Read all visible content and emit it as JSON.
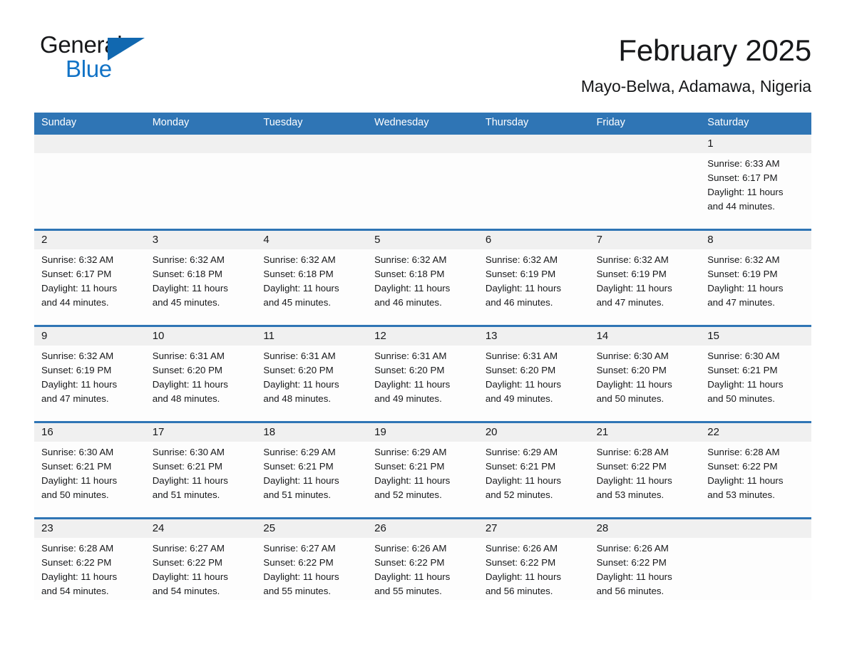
{
  "brand": {
    "name_part1": "General",
    "name_part2": "Blue",
    "triangle_icon": "brand-triangle-icon",
    "colors": {
      "black": "#17181a",
      "blue": "#1273c6",
      "triangle": "#1168b0"
    }
  },
  "header": {
    "title": "February 2025",
    "subtitle": "Mayo-Belwa, Adamawa, Nigeria"
  },
  "theme": {
    "header_blue": "#2f75b5",
    "day_band_gray": "#f0f0f0",
    "page_bg": "#ffffff",
    "text": "#17181a"
  },
  "weekdays": [
    "Sunday",
    "Monday",
    "Tuesday",
    "Wednesday",
    "Thursday",
    "Friday",
    "Saturday"
  ],
  "weeks": [
    [
      {
        "day": "",
        "lines": []
      },
      {
        "day": "",
        "lines": []
      },
      {
        "day": "",
        "lines": []
      },
      {
        "day": "",
        "lines": []
      },
      {
        "day": "",
        "lines": []
      },
      {
        "day": "",
        "lines": []
      },
      {
        "day": "1",
        "lines": [
          "Sunrise: 6:33 AM",
          "Sunset: 6:17 PM",
          "Daylight: 11 hours",
          "and 44 minutes."
        ]
      }
    ],
    [
      {
        "day": "2",
        "lines": [
          "Sunrise: 6:32 AM",
          "Sunset: 6:17 PM",
          "Daylight: 11 hours",
          "and 44 minutes."
        ]
      },
      {
        "day": "3",
        "lines": [
          "Sunrise: 6:32 AM",
          "Sunset: 6:18 PM",
          "Daylight: 11 hours",
          "and 45 minutes."
        ]
      },
      {
        "day": "4",
        "lines": [
          "Sunrise: 6:32 AM",
          "Sunset: 6:18 PM",
          "Daylight: 11 hours",
          "and 45 minutes."
        ]
      },
      {
        "day": "5",
        "lines": [
          "Sunrise: 6:32 AM",
          "Sunset: 6:18 PM",
          "Daylight: 11 hours",
          "and 46 minutes."
        ]
      },
      {
        "day": "6",
        "lines": [
          "Sunrise: 6:32 AM",
          "Sunset: 6:19 PM",
          "Daylight: 11 hours",
          "and 46 minutes."
        ]
      },
      {
        "day": "7",
        "lines": [
          "Sunrise: 6:32 AM",
          "Sunset: 6:19 PM",
          "Daylight: 11 hours",
          "and 47 minutes."
        ]
      },
      {
        "day": "8",
        "lines": [
          "Sunrise: 6:32 AM",
          "Sunset: 6:19 PM",
          "Daylight: 11 hours",
          "and 47 minutes."
        ]
      }
    ],
    [
      {
        "day": "9",
        "lines": [
          "Sunrise: 6:32 AM",
          "Sunset: 6:19 PM",
          "Daylight: 11 hours",
          "and 47 minutes."
        ]
      },
      {
        "day": "10",
        "lines": [
          "Sunrise: 6:31 AM",
          "Sunset: 6:20 PM",
          "Daylight: 11 hours",
          "and 48 minutes."
        ]
      },
      {
        "day": "11",
        "lines": [
          "Sunrise: 6:31 AM",
          "Sunset: 6:20 PM",
          "Daylight: 11 hours",
          "and 48 minutes."
        ]
      },
      {
        "day": "12",
        "lines": [
          "Sunrise: 6:31 AM",
          "Sunset: 6:20 PM",
          "Daylight: 11 hours",
          "and 49 minutes."
        ]
      },
      {
        "day": "13",
        "lines": [
          "Sunrise: 6:31 AM",
          "Sunset: 6:20 PM",
          "Daylight: 11 hours",
          "and 49 minutes."
        ]
      },
      {
        "day": "14",
        "lines": [
          "Sunrise: 6:30 AM",
          "Sunset: 6:20 PM",
          "Daylight: 11 hours",
          "and 50 minutes."
        ]
      },
      {
        "day": "15",
        "lines": [
          "Sunrise: 6:30 AM",
          "Sunset: 6:21 PM",
          "Daylight: 11 hours",
          "and 50 minutes."
        ]
      }
    ],
    [
      {
        "day": "16",
        "lines": [
          "Sunrise: 6:30 AM",
          "Sunset: 6:21 PM",
          "Daylight: 11 hours",
          "and 50 minutes."
        ]
      },
      {
        "day": "17",
        "lines": [
          "Sunrise: 6:30 AM",
          "Sunset: 6:21 PM",
          "Daylight: 11 hours",
          "and 51 minutes."
        ]
      },
      {
        "day": "18",
        "lines": [
          "Sunrise: 6:29 AM",
          "Sunset: 6:21 PM",
          "Daylight: 11 hours",
          "and 51 minutes."
        ]
      },
      {
        "day": "19",
        "lines": [
          "Sunrise: 6:29 AM",
          "Sunset: 6:21 PM",
          "Daylight: 11 hours",
          "and 52 minutes."
        ]
      },
      {
        "day": "20",
        "lines": [
          "Sunrise: 6:29 AM",
          "Sunset: 6:21 PM",
          "Daylight: 11 hours",
          "and 52 minutes."
        ]
      },
      {
        "day": "21",
        "lines": [
          "Sunrise: 6:28 AM",
          "Sunset: 6:22 PM",
          "Daylight: 11 hours",
          "and 53 minutes."
        ]
      },
      {
        "day": "22",
        "lines": [
          "Sunrise: 6:28 AM",
          "Sunset: 6:22 PM",
          "Daylight: 11 hours",
          "and 53 minutes."
        ]
      }
    ],
    [
      {
        "day": "23",
        "lines": [
          "Sunrise: 6:28 AM",
          "Sunset: 6:22 PM",
          "Daylight: 11 hours",
          "and 54 minutes."
        ]
      },
      {
        "day": "24",
        "lines": [
          "Sunrise: 6:27 AM",
          "Sunset: 6:22 PM",
          "Daylight: 11 hours",
          "and 54 minutes."
        ]
      },
      {
        "day": "25",
        "lines": [
          "Sunrise: 6:27 AM",
          "Sunset: 6:22 PM",
          "Daylight: 11 hours",
          "and 55 minutes."
        ]
      },
      {
        "day": "26",
        "lines": [
          "Sunrise: 6:26 AM",
          "Sunset: 6:22 PM",
          "Daylight: 11 hours",
          "and 55 minutes."
        ]
      },
      {
        "day": "27",
        "lines": [
          "Sunrise: 6:26 AM",
          "Sunset: 6:22 PM",
          "Daylight: 11 hours",
          "and 56 minutes."
        ]
      },
      {
        "day": "28",
        "lines": [
          "Sunrise: 6:26 AM",
          "Sunset: 6:22 PM",
          "Daylight: 11 hours",
          "and 56 minutes."
        ]
      },
      {
        "day": "",
        "lines": []
      }
    ]
  ]
}
